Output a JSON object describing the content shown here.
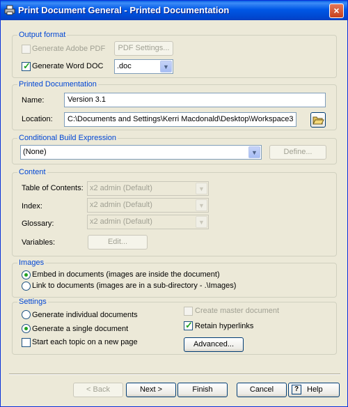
{
  "window": {
    "title": "Print Document General - Printed Documentation",
    "close_label": "×"
  },
  "output_format": {
    "label": "Output format",
    "generate_pdf_label": "Generate Adobe PDF",
    "generate_pdf_checked": false,
    "pdf_settings_label": "PDF Settings...",
    "generate_word_label": "Generate Word DOC",
    "generate_word_checked": true,
    "word_format_value": ".doc"
  },
  "printed_documentation": {
    "label": "Printed Documentation",
    "name_label": "Name:",
    "name_value": "Version 3.1",
    "location_label": "Location:",
    "location_value": "C:\\Documents and Settings\\Kerri Macdonald\\Desktop\\Workspace3"
  },
  "conditional_build": {
    "label": "Conditional Build Expression",
    "value": "(None)",
    "define_label": "Define..."
  },
  "content": {
    "label": "Content",
    "toc_label": "Table of Contents:",
    "toc_value": "x2 admin (Default)",
    "index_label": "Index:",
    "index_value": "x2 admin (Default)",
    "glossary_label": "Glossary:",
    "glossary_value": "x2 admin (Default)",
    "variables_label": "Variables:",
    "edit_label": "Edit..."
  },
  "images": {
    "label": "Images",
    "embed_label": "Embed in documents (images are inside the document)",
    "link_label": "Link to documents (images are in a sub-directory - .\\Images)",
    "selected": "embed"
  },
  "settings": {
    "label": "Settings",
    "individual_label": "Generate individual documents",
    "single_label": "Generate a single document",
    "selected": "single",
    "new_page_label": "Start each topic on a new page",
    "new_page_checked": false,
    "master_label": "Create master document",
    "master_checked": false,
    "retain_label": "Retain hyperlinks",
    "retain_checked": true,
    "advanced_label": "Advanced..."
  },
  "footer": {
    "back_label": "< Back",
    "next_label": "Next >",
    "finish_label": "Finish",
    "cancel_label": "Cancel",
    "help_label": "Help",
    "help_icon_glyph": "?"
  }
}
